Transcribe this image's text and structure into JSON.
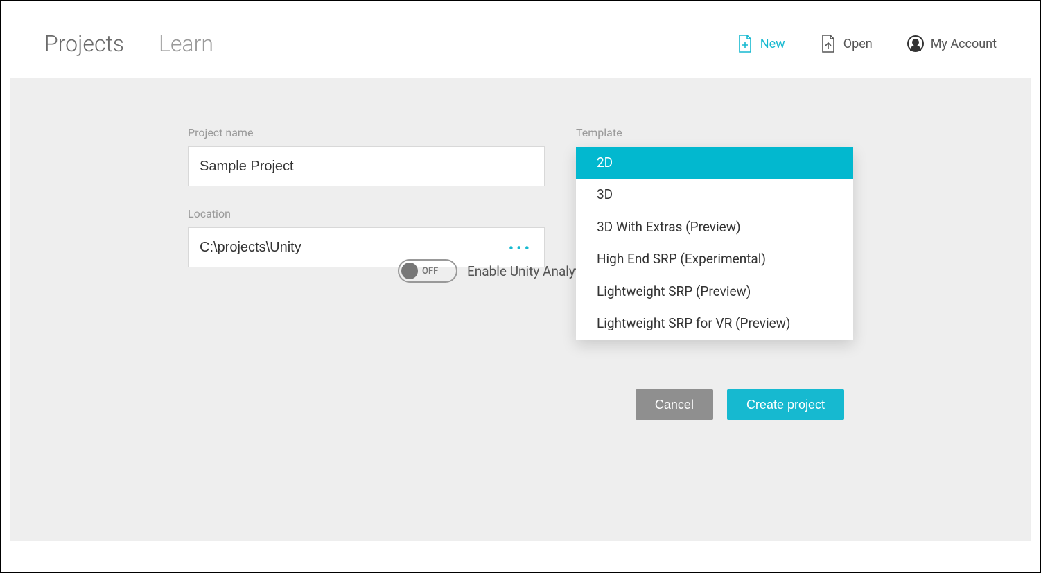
{
  "header": {
    "tabs": {
      "projects": "Projects",
      "learn": "Learn"
    },
    "new_label": "New",
    "open_label": "Open",
    "account_label": "My Account"
  },
  "form": {
    "project_name_label": "Project name",
    "project_name_value": "Sample Project",
    "location_label": "Location",
    "location_value": "C:\\projects\\Unity",
    "template_label": "Template"
  },
  "template_options": [
    "2D",
    "3D",
    "3D With Extras (Preview)",
    "High End SRP (Experimental)",
    "Lightweight SRP (Preview)",
    "Lightweight SRP for VR (Preview)"
  ],
  "template_selected_index": 0,
  "analytics": {
    "toggle_state": "OFF",
    "label": "Enable Unity Analytics",
    "help": "?"
  },
  "buttons": {
    "cancel": "Cancel",
    "create": "Create project"
  },
  "colors": {
    "accent": "#16b9d0"
  }
}
